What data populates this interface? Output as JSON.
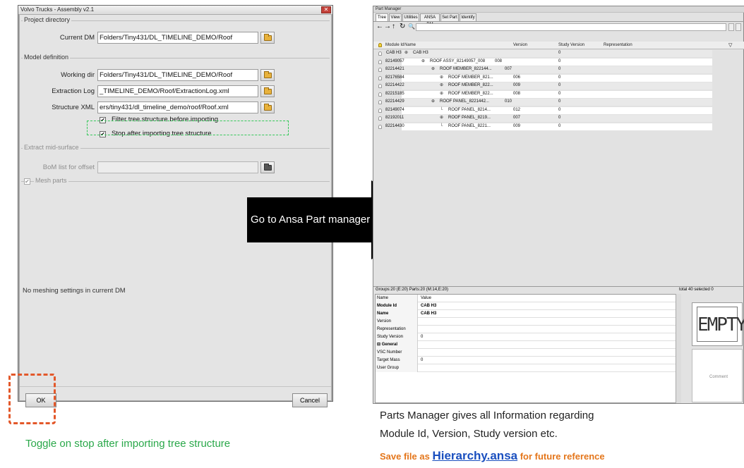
{
  "dialog": {
    "title": "Volvo Trucks - Assembly v2.1",
    "close_glyph": "✕",
    "sections": {
      "project_directory": "Project directory",
      "model_definition": "Model definition",
      "extract_mid_surface": "Extract mid-surface",
      "mesh_parts": "Mesh parts"
    },
    "fields": {
      "current_dm_label": "Current DM",
      "current_dm_value": "Folders/Tiny431/DL_TIMELINE_DEMO/Roof",
      "working_dir_label": "Working dir",
      "working_dir_value": "Folders/Tiny431/DL_TIMELINE_DEMO/Roof",
      "extraction_log_label": "Extraction Log",
      "extraction_log_value": "_TIMELINE_DEMO/Roof/ExtractionLog.xml",
      "structure_xml_label": "Structure XML",
      "structure_xml_value": "ers/tiny431/dl_timeline_demo/roof/Roof.xml",
      "bom_list_label": "BoM list for offset",
      "bom_list_value": ""
    },
    "checkboxes": {
      "filter_tree": "Filter tree structure before importing",
      "stop_after_import": "Stop after importing tree structure",
      "check_glyph": "✔"
    },
    "mesh_message": "No meshing settings in current DM",
    "ok_label": "OK",
    "cancel_label": "Cancel"
  },
  "arrow_label": "Go to Ansa Part manager",
  "part_manager": {
    "title": "Part Manager",
    "tabs": [
      "Tree",
      "View",
      "Utilities",
      "ANSA DM",
      "Set Part",
      "Identify"
    ],
    "toolbar": [
      "←",
      "→",
      "↑",
      "↻",
      "🔍"
    ],
    "columns": [
      "Module Id",
      "Name",
      "Version",
      "Study Version",
      "Representation"
    ],
    "rows": [
      {
        "module_id": "CAB H3",
        "name": "CAB H3",
        "version": "",
        "study": "0",
        "indent": 0,
        "node": "⊕"
      },
      {
        "module_id": "82149057",
        "name": "ROOF ASSY_82149057_008",
        "version": "008",
        "study": "0",
        "indent": 1,
        "node": "⊕"
      },
      {
        "module_id": "82214421",
        "name": "ROOF MEMBER_822144...",
        "version": "007",
        "study": "0",
        "indent": 2,
        "node": "⊕"
      },
      {
        "module_id": "82176584",
        "name": "ROOF MEMBER_821...",
        "version": "006",
        "study": "0",
        "indent": 3,
        "node": "⊕"
      },
      {
        "module_id": "82214422",
        "name": "ROOF MEMBER_822...",
        "version": "009",
        "study": "0",
        "indent": 3,
        "node": "⊕"
      },
      {
        "module_id": "82215185",
        "name": "ROOF MEMBER_822...",
        "version": "008",
        "study": "0",
        "indent": 3,
        "node": "⊕"
      },
      {
        "module_id": "82214429",
        "name": "ROOF PANEL_8221442...",
        "version": "010",
        "study": "0",
        "indent": 2,
        "node": "⊕"
      },
      {
        "module_id": "82149074",
        "name": "ROOF PANEL_8214...",
        "version": "012",
        "study": "0",
        "indent": 3,
        "node": "└"
      },
      {
        "module_id": "82192011",
        "name": "ROOF PANEL_8219...",
        "version": "007",
        "study": "0",
        "indent": 3,
        "node": "⊕"
      },
      {
        "module_id": "82214430",
        "name": "ROOF PANEL_8221...",
        "version": "009",
        "study": "0",
        "indent": 3,
        "node": "└"
      }
    ],
    "status_groups": "Groups:20 (E:20) Parts:20 (M:14,E:20)",
    "status_total": "total  40    selected 0",
    "properties": {
      "header_name": "Name",
      "header_value": "Value",
      "rows": [
        {
          "name": "Module Id",
          "value": "CAB H3",
          "bold": true
        },
        {
          "name": "Name",
          "value": "CAB H3",
          "bold": true
        },
        {
          "name": "Version",
          "value": "",
          "bold": false
        },
        {
          "name": "Representation",
          "value": "",
          "bold": false
        },
        {
          "name": "Study Version",
          "value": "0",
          "bold": false
        },
        {
          "name": "⊟ General",
          "value": "",
          "bold": true
        },
        {
          "name": "VSC Number",
          "value": "",
          "bold": false
        },
        {
          "name": "Target Mass",
          "value": "0",
          "bold": false
        },
        {
          "name": "User Group",
          "value": "",
          "bold": false
        }
      ]
    },
    "empty_label": "EMPTY",
    "comment_label": "Comment"
  },
  "captions": {
    "pm_line1": "Parts Manager gives all Information regarding",
    "pm_line2": "Module Id, Version, Study version etc.",
    "save_prefix": "Save file as ",
    "save_link": "Hierarchy.ansa",
    "save_suffix": " for future reference",
    "toggle": "Toggle on stop after importing tree structure"
  },
  "colors": {
    "caption_green": "#2aa84a",
    "caption_orange": "#e4761b",
    "link_blue": "#1a4fbf",
    "dash_red": "#e3582a",
    "dash_green": "#36c85a"
  }
}
